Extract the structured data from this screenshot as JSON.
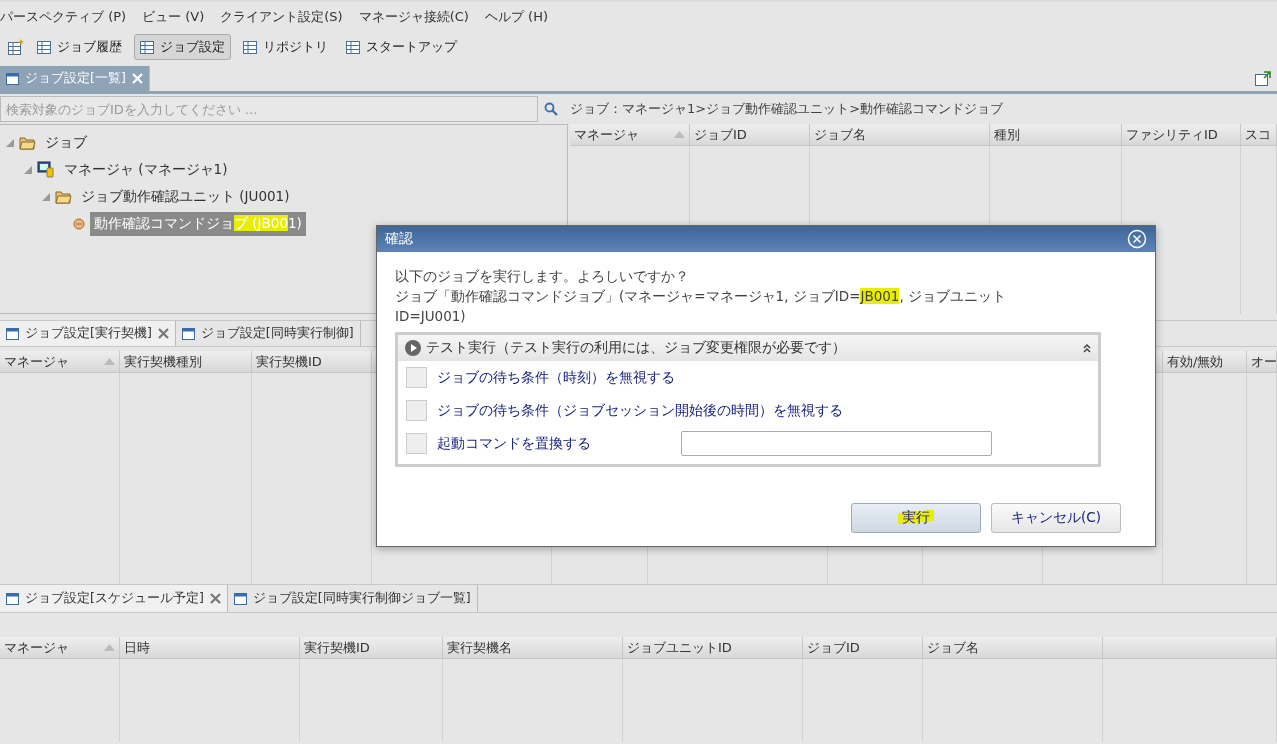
{
  "menu_bar": [
    "パースペクティブ (P)",
    "ビュー (V)",
    "クライアント設定(S)",
    "マネージャ接続(C)",
    "ヘルプ (H)"
  ],
  "toolbar": [
    {
      "label": "ジョブ履歴",
      "selected": false
    },
    {
      "label": "ジョブ設定",
      "selected": true
    },
    {
      "label": "リポジトリ",
      "selected": false
    },
    {
      "label": "スタートアップ",
      "selected": false
    }
  ],
  "job_list_view": {
    "tabs": [
      {
        "label": "ジョブ設定[一覧]",
        "selected": true
      }
    ],
    "search": {
      "placeholder": "検索対象のジョブIDを入力してください ..."
    },
    "breadcrumb": "ジョブ：マネージャ1>ジョブ動作確認ユニット>動作確認コマンドジョブ",
    "tree": [
      {
        "kind": "folder",
        "label": [
          {
            "text": "ジョブ",
            "marked": false
          }
        ],
        "expanded": true,
        "selected": false,
        "children": [
          {
            "kind": "manager",
            "label": [
              {
                "text": "マネージャ (マネージャ1)",
                "marked": false
              }
            ],
            "expanded": true,
            "selected": false,
            "children": [
              {
                "kind": "folder",
                "label": [
                  {
                    "text": "ジョブ動作確認ユニット (JU001)",
                    "marked": false
                  }
                ],
                "expanded": true,
                "selected": false,
                "children": [
                  {
                    "kind": "job",
                    "label": [
                      {
                        "text": "動作確認コマンドジョ",
                        "marked": false
                      },
                      {
                        "text": "ブ (JB00",
                        "marked": true
                      },
                      {
                        "text": "1)",
                        "marked": false
                      }
                    ],
                    "selected": true
                  }
                ]
              }
            ]
          }
        ]
      }
    ],
    "table": {
      "columns": [
        {
          "label": "マネージャ",
          "sorted": true
        },
        {
          "label": "ジョブID"
        },
        {
          "label": "ジョブ名"
        },
        {
          "label": "種別"
        },
        {
          "label": "ファシリティID"
        },
        {
          "label": "スコ"
        }
      ]
    }
  },
  "trigger_view": {
    "tabs": [
      {
        "label": "ジョブ設定[実行契機]",
        "selected": true
      },
      {
        "label": "ジョブ設定[同時実行制御]",
        "selected": false
      }
    ],
    "columns": [
      {
        "label": "マネージャ",
        "sorted": true
      },
      {
        "label": "実行契機種別"
      },
      {
        "label": "実行契機ID"
      },
      {
        "label": "有効/無効"
      },
      {
        "label": "オー"
      }
    ]
  },
  "schedule_view": {
    "tabs": [
      {
        "label": "ジョブ設定[スケジュール予定]",
        "selected": true
      },
      {
        "label": "ジョブ設定[同時実行制御ジョブ一覧]",
        "selected": false
      }
    ],
    "columns": [
      {
        "label": "マネージャ",
        "sorted": true
      },
      {
        "label": "日時"
      },
      {
        "label": "実行契機ID"
      },
      {
        "label": "実行契機名"
      },
      {
        "label": "ジョブユニットID"
      },
      {
        "label": "ジョブID"
      },
      {
        "label": "ジョブ名"
      }
    ]
  },
  "dialog": {
    "title": "確認",
    "message": [
      [
        {
          "text": "以下のジョブを実行します。よろしいですか？",
          "marked": false
        }
      ],
      [
        {
          "text": "ジョブ「動作確認コマンドジョブ」(マネージャ=マネージャ1, ジョブID=",
          "marked": false
        },
        {
          "text": "JB001",
          "marked": true
        },
        {
          "text": ", ジョブユニットID=JU001)",
          "marked": false
        }
      ]
    ],
    "section": {
      "title": "テスト実行（テスト実行の利用には、ジョブ変更権限が必要です）",
      "expanded": true,
      "options": [
        {
          "kind": "checkbox",
          "label": "ジョブの待ち条件（時刻）を無視する",
          "checked": false
        },
        {
          "kind": "checkbox",
          "label": "ジョブの待ち条件（ジョブセッション開始後の時間）を無視する",
          "checked": false
        },
        {
          "kind": "checkbox_field",
          "label": "起動コマンドを置換する",
          "checked": false
        }
      ]
    },
    "buttons": [
      {
        "label": "実行",
        "marked": true
      },
      {
        "label": "キャンセル(C)",
        "marked": false
      }
    ]
  }
}
